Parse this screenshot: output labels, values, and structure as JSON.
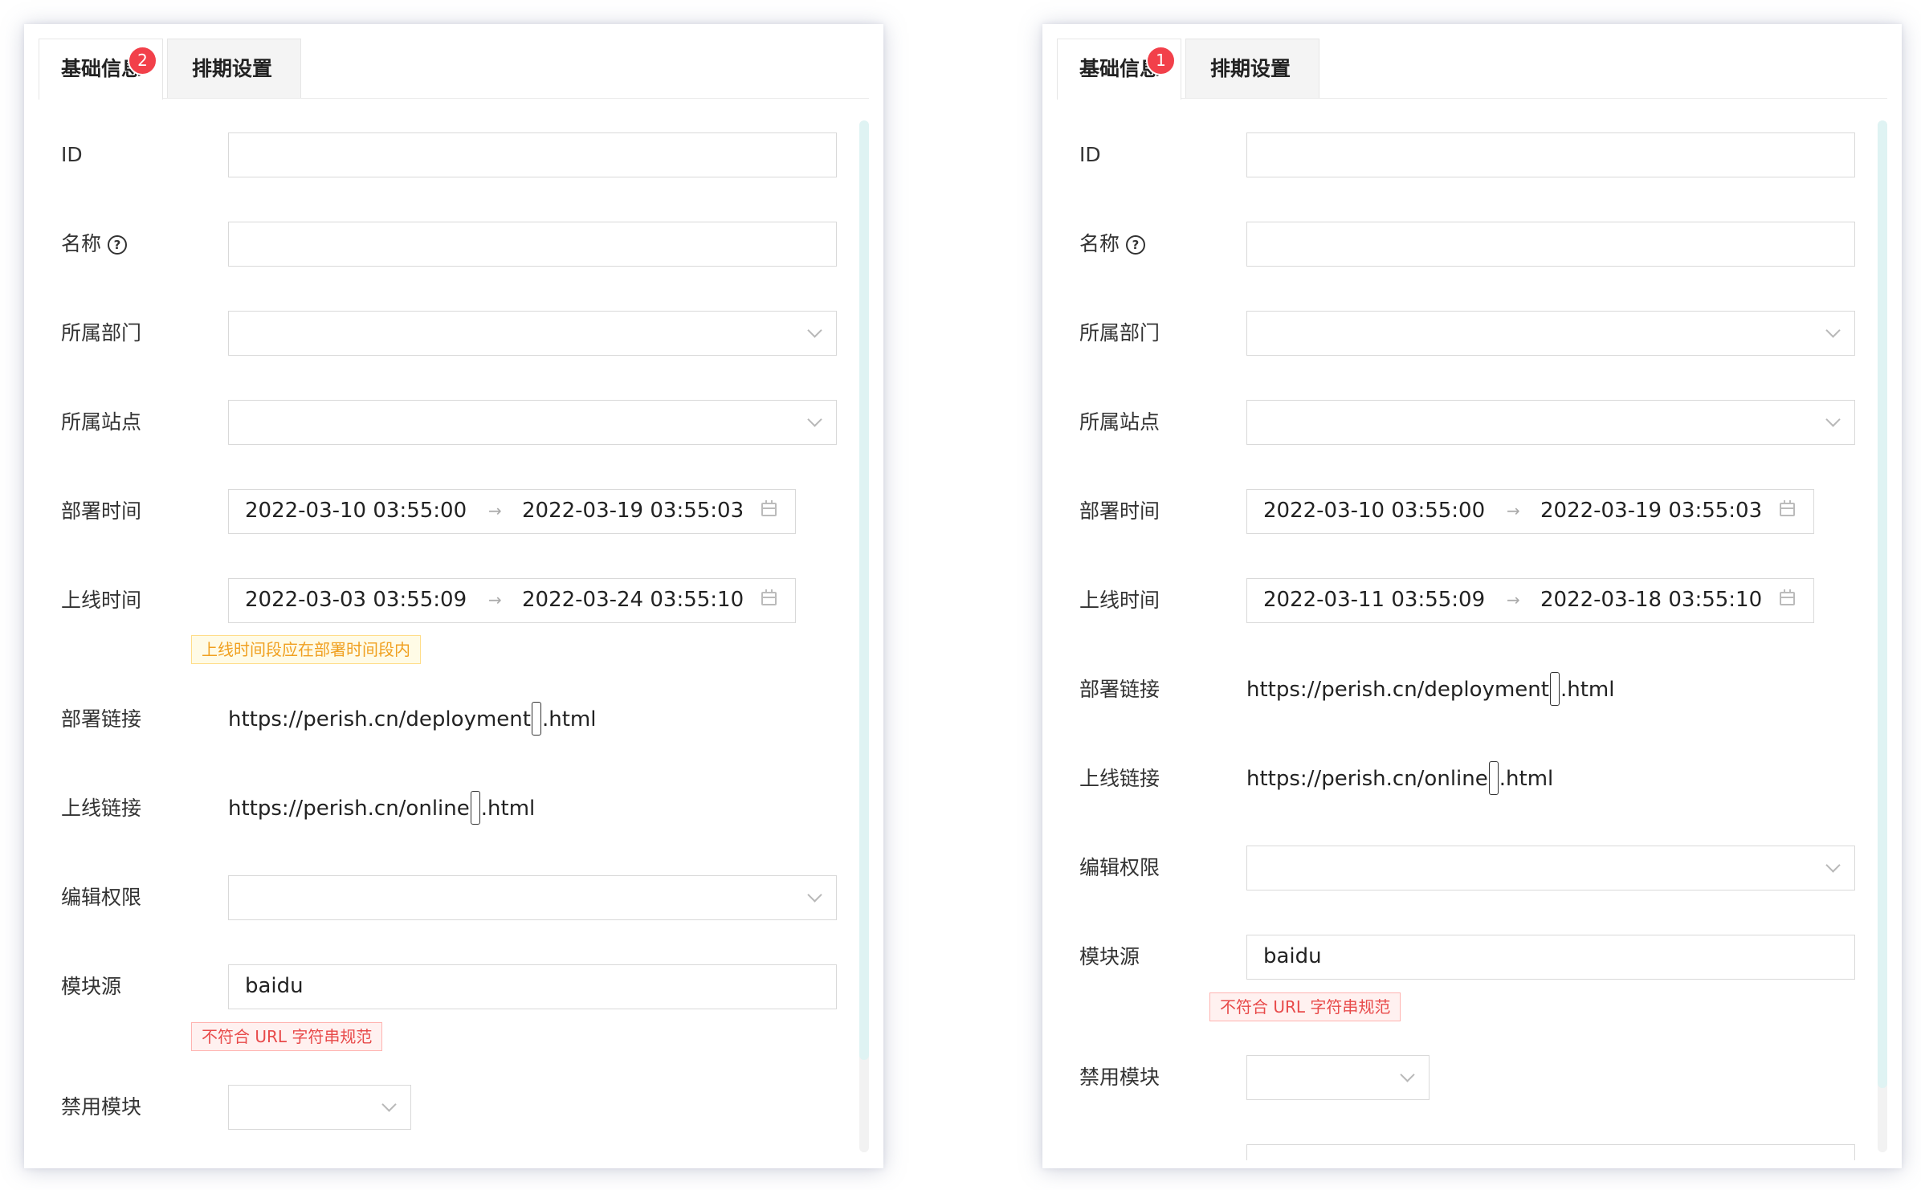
{
  "left": {
    "tabs": {
      "basic": "基础信息",
      "schedule": "排期设置"
    },
    "badge": "2",
    "fields": {
      "id_label": "ID",
      "name_label": "名称",
      "dept_label": "所属部门",
      "site_label": "所属站点",
      "deploy_time_label": "部署时间",
      "deploy_start": "2022-03-10 03:55:00",
      "deploy_end": "2022-03-19 03:55:03",
      "online_time_label": "上线时间",
      "online_start": "2022-03-03 03:55:09",
      "online_end": "2022-03-24 03:55:10",
      "online_warning": "上线时间段应在部署时间段内",
      "deploy_link_label": "部署链接",
      "deploy_link_prefix": "https://perish.cn/deployment",
      "deploy_link_suffix": ".html",
      "online_link_label": "上线链接",
      "online_link_prefix": "https://perish.cn/online",
      "online_link_suffix": ".html",
      "perm_label": "编辑权限",
      "module_source_label": "模块源",
      "module_source_value": "baidu",
      "module_source_error": "不符合 URL 字符串规范",
      "disable_module_label": "禁用模块"
    }
  },
  "right": {
    "tabs": {
      "basic": "基础信息",
      "schedule": "排期设置"
    },
    "badge": "1",
    "fields": {
      "id_label": "ID",
      "name_label": "名称",
      "dept_label": "所属部门",
      "site_label": "所属站点",
      "deploy_time_label": "部署时间",
      "deploy_start": "2022-03-10 03:55:00",
      "deploy_end": "2022-03-19 03:55:03",
      "online_time_label": "上线时间",
      "online_start": "2022-03-11 03:55:09",
      "online_end": "2022-03-18 03:55:10",
      "deploy_link_label": "部署链接",
      "deploy_link_prefix": "https://perish.cn/deployment",
      "deploy_link_suffix": ".html",
      "online_link_label": "上线链接",
      "online_link_prefix": "https://perish.cn/online",
      "online_link_suffix": ".html",
      "perm_label": "编辑权限",
      "module_source_label": "模块源",
      "module_source_value": "baidu",
      "module_source_error": "不符合 URL 字符串规范",
      "disable_module_label": "禁用模块"
    }
  },
  "icons": {
    "help": "?",
    "arrow": "→"
  }
}
